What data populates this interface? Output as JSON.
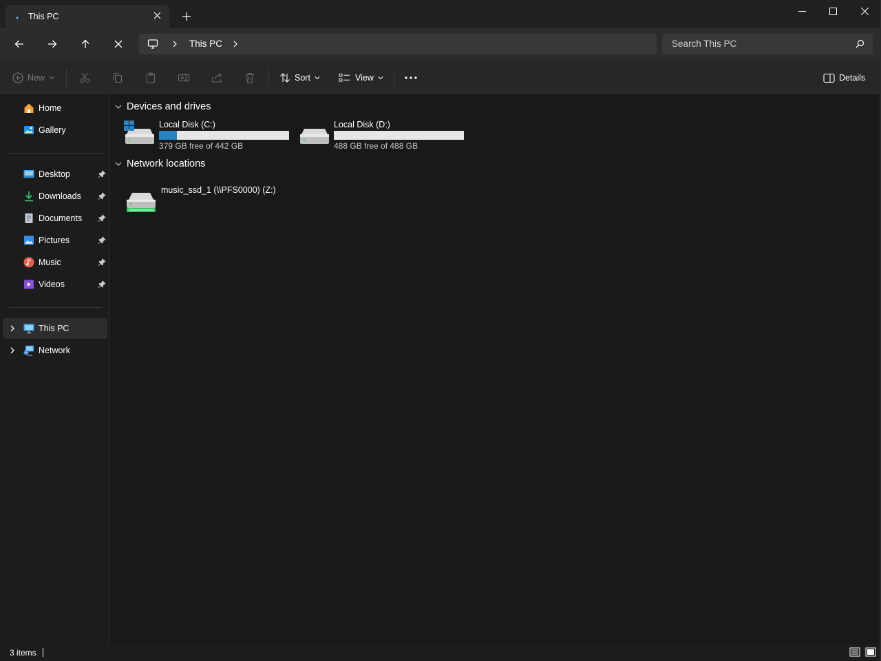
{
  "window": {
    "tab_title": "This PC",
    "new_tab_symbol": "+",
    "controls": [
      "minimize-icon",
      "maximize-icon",
      "close-icon"
    ]
  },
  "navigation": {
    "back": "arrow-left-icon",
    "forward": "arrow-right-icon",
    "up": "arrow-up-icon",
    "stop": "close-icon",
    "breadcrumb": [
      "This PC"
    ],
    "search_placeholder": "Search This PC"
  },
  "toolbar": {
    "new_label": "New",
    "sort_label": "Sort",
    "view_label": "View",
    "more_label": "···",
    "details_label": "Details",
    "disabled_actions": [
      "cut-icon",
      "copy-icon",
      "paste-icon",
      "rename-icon",
      "share-icon",
      "delete-icon"
    ]
  },
  "sidebar": {
    "top_items": [
      {
        "label": "Home",
        "icon": "home-icon"
      },
      {
        "label": "Gallery",
        "icon": "gallery-icon"
      }
    ],
    "pinned_items": [
      {
        "label": "Desktop",
        "icon": "desktop-icon",
        "color": "#3ba3e6"
      },
      {
        "label": "Downloads",
        "icon": "download-icon",
        "color": "#3fc46e"
      },
      {
        "label": "Documents",
        "icon": "document-icon",
        "color": "#9aa4b8"
      },
      {
        "label": "Pictures",
        "icon": "pictures-icon",
        "color": "#3b8ee6"
      },
      {
        "label": "Music",
        "icon": "music-icon",
        "color": "#e8604c"
      },
      {
        "label": "Videos",
        "icon": "videos-icon",
        "color": "#8a4fd8"
      }
    ],
    "tree_items": [
      {
        "label": "This PC",
        "icon": "pc-icon",
        "selected": true
      },
      {
        "label": "Network",
        "icon": "network-icon",
        "selected": false
      }
    ]
  },
  "content": {
    "groups": {
      "devices": "Devices and drives",
      "network": "Network locations"
    },
    "drives": [
      {
        "name": "Local Disk (C:)",
        "free": "379 GB free of 442 GB",
        "used_fraction": 0.14,
        "system": true
      },
      {
        "name": "Local Disk (D:)",
        "free": "488 GB free of 488 GB",
        "used_fraction": 0.0,
        "system": false
      }
    ],
    "network_drives": [
      {
        "name": "music_ssd_1 (\\\\PFS0000) (Z:)"
      }
    ]
  },
  "status": {
    "item_count": "3 items"
  },
  "colors": {
    "accent": "#2683c6",
    "background": "#191919",
    "sidebar_selected": "#2d2d2d"
  }
}
